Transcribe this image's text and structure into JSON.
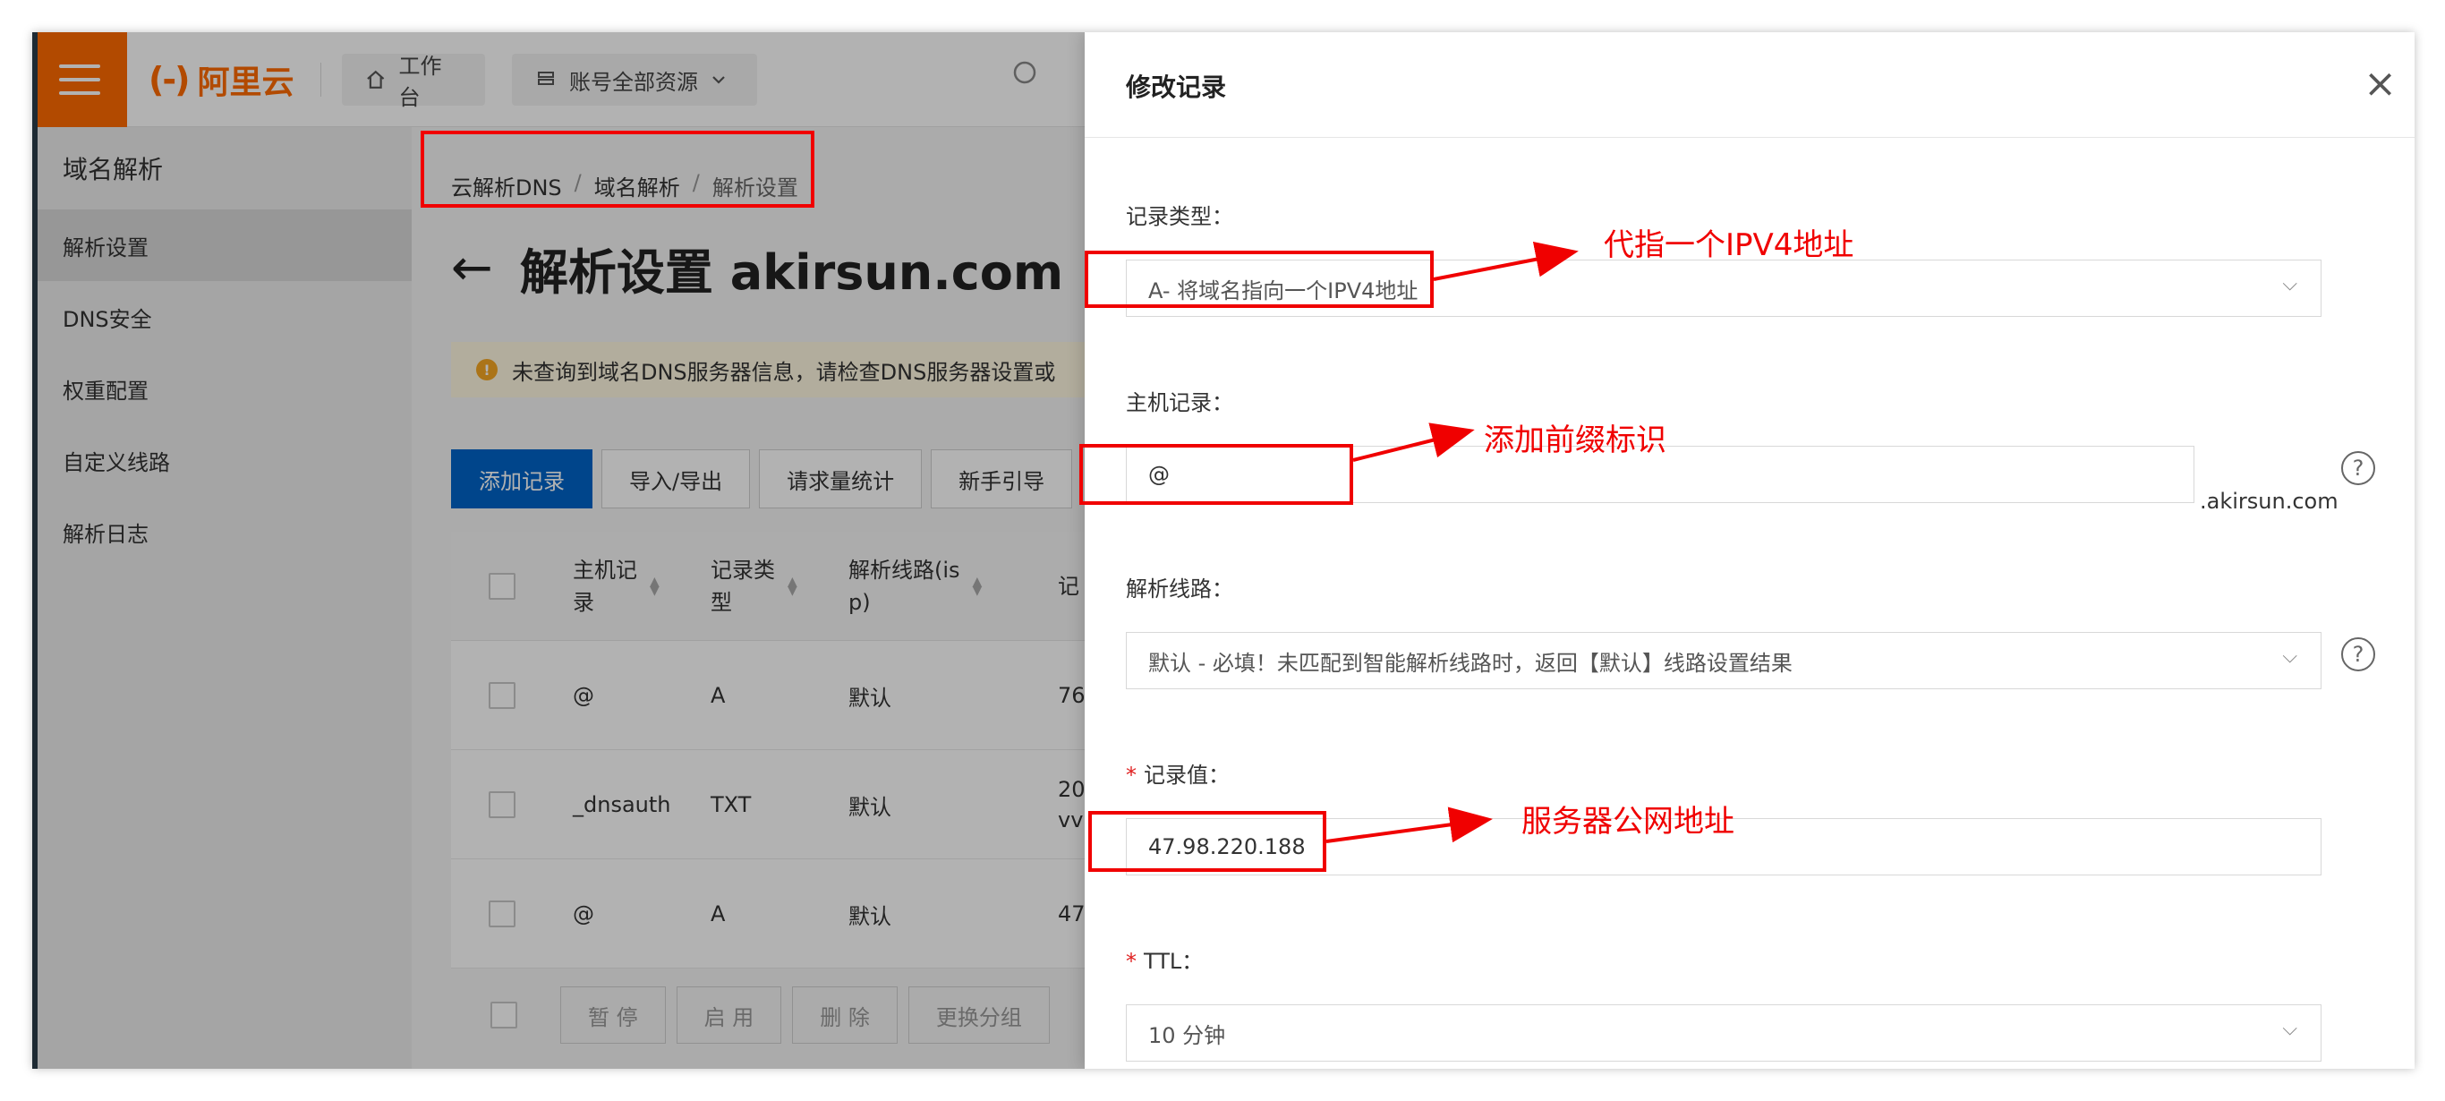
{
  "colors": {
    "brand": "#ff6a00",
    "primary": "#0064c8",
    "annotation": "#f00000",
    "warning": "#f5a623"
  },
  "topbar": {
    "logo_mark": "(-)",
    "logo_text": "阿里云",
    "workbench_label": "工作台",
    "resources_label": "账号全部资源",
    "icons": {
      "menu": "hamburger-icon",
      "home": "home-icon",
      "resources": "stack-icon",
      "search": "search-icon"
    }
  },
  "sidebar": {
    "title": "域名解析",
    "items": [
      {
        "label": "解析设置",
        "active": true
      },
      {
        "label": "DNS安全"
      },
      {
        "label": "权重配置"
      },
      {
        "label": "自定义线路"
      },
      {
        "label": "解析日志"
      }
    ]
  },
  "breadcrumb": {
    "item1": "云解析DNS",
    "item2": "域名解析",
    "item3": "解析设置",
    "separator": "/"
  },
  "page": {
    "title": "解析设置 akirsun.com",
    "notice": "未查询到域名DNS服务器信息，请检查DNS服务器设置或"
  },
  "toolbar": {
    "add_record": "添加记录",
    "import_export": "导入/导出",
    "request_stats": "请求量统计",
    "beginner_guide": "新手引导"
  },
  "table": {
    "headers": {
      "host": "主机记\n录",
      "type": "记录类\n型",
      "line": "解析线路(is\np)",
      "value": "记"
    },
    "rows": [
      {
        "host": "@",
        "type": "A",
        "line": "默认",
        "value": "76"
      },
      {
        "host": "_dnsauth",
        "type": "TXT",
        "line": "默认",
        "value": "20\nvv"
      },
      {
        "host": "@",
        "type": "A",
        "line": "默认",
        "value": "47"
      }
    ],
    "batch_actions": {
      "pause": "暂 停",
      "enable": "启 用",
      "delete": "删 除",
      "change_group": "更换分组"
    }
  },
  "drawer": {
    "title": "修改记录",
    "close_glyph": "×",
    "record_type_label": "记录类型：",
    "record_type_value": "A- 将域名指向一个IPV4地址",
    "host_label": "主机记录：",
    "host_value": "@",
    "host_suffix": ".akirsun.com",
    "line_label": "解析线路：",
    "line_value": "默认 - 必填！未匹配到智能解析线路时，返回【默认】线路设置结果",
    "value_label": "记录值：",
    "value_value": "47.98.220.188",
    "ttl_label": "TTL：",
    "ttl_value": "10 分钟",
    "required_mark": "*",
    "help_glyph": "?",
    "chevron_glyph": "⌵"
  },
  "annotations": {
    "record_type": "代指一个IPV4地址",
    "host": "添加前缀标识",
    "value": "服务器公网地址"
  }
}
